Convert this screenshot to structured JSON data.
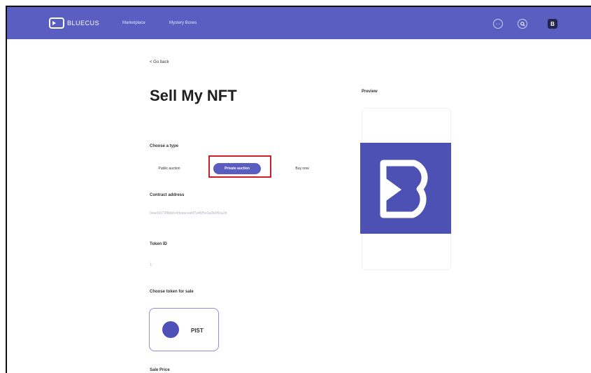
{
  "header": {
    "brand": "BLUECUS",
    "nav": [
      "Marketplace",
      "Mystery Boxes"
    ],
    "icons": [
      "more-icon",
      "search-icon",
      "avatar-logo"
    ],
    "more_glyph": "···"
  },
  "page": {
    "back_label": "< Go back",
    "title": "Sell My NFT",
    "choose_type_label": "Choose a type",
    "types": [
      "Public auction",
      "Private auction",
      "Buy now"
    ],
    "selected_type": "Private auction",
    "contract_label": "Contract address",
    "contract_value": "0xaef4273f8bbfe4deaacea6f7a4bf5e0a0b0f5ca2d",
    "token_id_label": "Token ID",
    "token_id_value": "1",
    "choose_token_label": "Choose token for sale",
    "token_symbol": "PIST",
    "sale_price_label": "Sale Price"
  },
  "preview": {
    "label": "Preview"
  },
  "colors": {
    "brand": "#5a5ec0",
    "highlight": "#cc1f2a"
  }
}
